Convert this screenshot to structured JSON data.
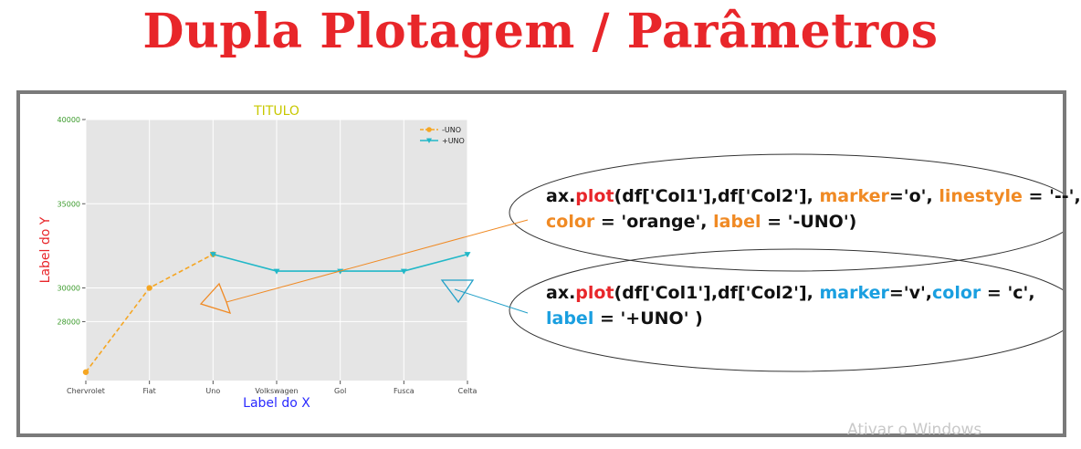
{
  "page": {
    "title": "Dupla Plotagem / Parâmetros",
    "watermark": "Ativar o Windows"
  },
  "annotations": {
    "code1": {
      "p1": "ax.",
      "p2": "plot",
      "p3": "(df['Col1'],df['Col2'], ",
      "p4": "marker",
      "p5": "='o', ",
      "p6": "linestyle",
      "p7": " = '--',",
      "p8": "color",
      "p9": " = 'orange', ",
      "p10": "label",
      "p11": " = '-UNO')"
    },
    "code2": {
      "p1": "ax.",
      "p2": "plot",
      "p3": "(df['Col1'],df['Col2'], ",
      "p4": "marker",
      "p5": "='v',",
      "p6": "color",
      "p7": " = 'c',",
      "p8": "label",
      "p9": " = '+UNO' )"
    }
  },
  "colors": {
    "title_red": "#e8262a",
    "orange": "#f5a623",
    "cyan": "#22b8c8",
    "plot_bg": "#e5e5e5",
    "ylabel_red": "#e8262a",
    "xlabel_blue": "#2a2aff",
    "chart_title": "#c8c800",
    "ytick_green": "#3a9a2a"
  },
  "chart_data": {
    "type": "line",
    "title": "TITULO",
    "xlabel": "Label do X",
    "ylabel": "Label do Y",
    "categories": [
      "Chervrolet",
      "Fiat",
      "Uno",
      "Volkswagen",
      "Gol",
      "Fusca",
      "Celta"
    ],
    "yticks": [
      28000,
      30000,
      35000,
      40000
    ],
    "ylim": [
      24500,
      40000
    ],
    "grid": true,
    "legend_position": "top-right",
    "series": [
      {
        "name": "-UNO",
        "color": "orange",
        "linestyle": "dashed",
        "marker": "o",
        "values": [
          25000,
          30000,
          32000,
          null,
          null,
          null,
          null
        ]
      },
      {
        "name": "+UNO",
        "color": "c",
        "linestyle": "solid",
        "marker": "v",
        "values": [
          null,
          null,
          32000,
          31000,
          31000,
          31000,
          32000
        ]
      }
    ]
  }
}
